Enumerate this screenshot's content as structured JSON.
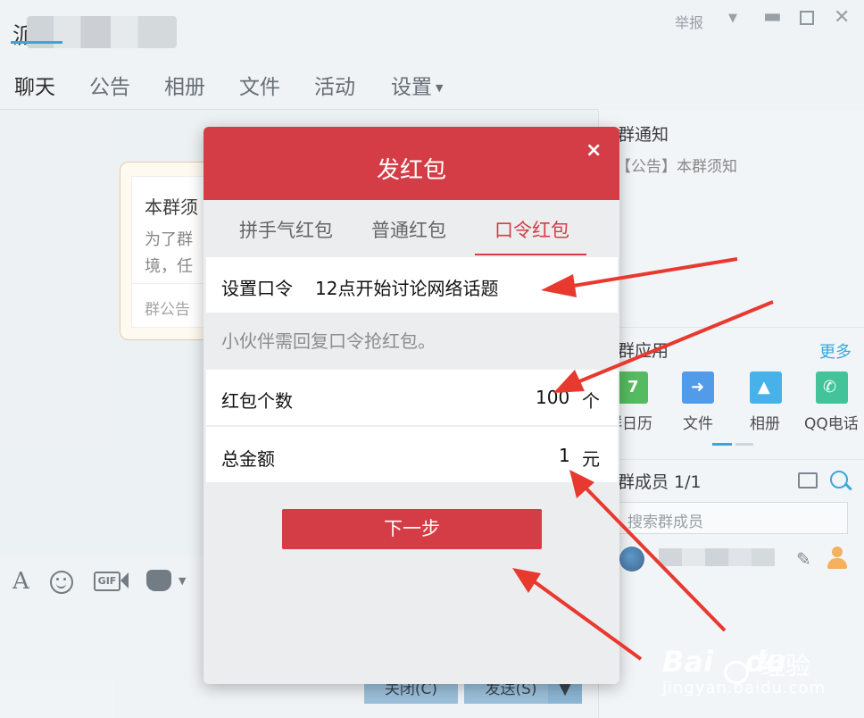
{
  "window": {
    "title_visible_char": "派",
    "report_label": "举报"
  },
  "nav": {
    "tabs": [
      "聊天",
      "公告",
      "相册",
      "文件",
      "活动",
      "设置"
    ],
    "active_index": 0
  },
  "notice_card": {
    "title": "本群须",
    "body_line1": "为了群",
    "body_line2": "境，任",
    "footer": "群公告"
  },
  "bottom_buttons": {
    "close_label": "关闭(C)",
    "send_label": "发送(S)"
  },
  "right_panel": {
    "notice_title": "群通知",
    "notice_text": "【公告】本群须知",
    "apps_title": "群应用",
    "apps_more": "更多",
    "apps": [
      {
        "label": "群日历",
        "icon": "calendar-icon"
      },
      {
        "label": "文件",
        "icon": "file-share-icon"
      },
      {
        "label": "相册",
        "icon": "photo-icon"
      },
      {
        "label": "QQ电话",
        "icon": "phone-icon"
      }
    ],
    "members_title": "群成员 1/1",
    "members_search_placeholder": "搜索群成员"
  },
  "dialog": {
    "title": "发红包",
    "close_glyph": "×",
    "tabs": [
      "拼手气红包",
      "普通红包",
      "口令红包"
    ],
    "active_tab_index": 2,
    "password_label": "设置口令",
    "password_value": "12点开始讨论网络话题",
    "hint": "小伙伴需回复口令抢红包。",
    "count_label": "红包个数",
    "count_value": "100",
    "count_unit": "个",
    "amount_label": "总金额",
    "amount_value": "1",
    "amount_unit": "元",
    "next_button": "下一步"
  },
  "watermark": {
    "brand": "Bai",
    "brand_suffix": "du",
    "jingyan": "经验",
    "url": "jingyan.baidu.com"
  },
  "colors": {
    "accent_blue": "#1e9bd7",
    "packet_red": "#d43d45",
    "annotation_red": "#e8392f"
  }
}
